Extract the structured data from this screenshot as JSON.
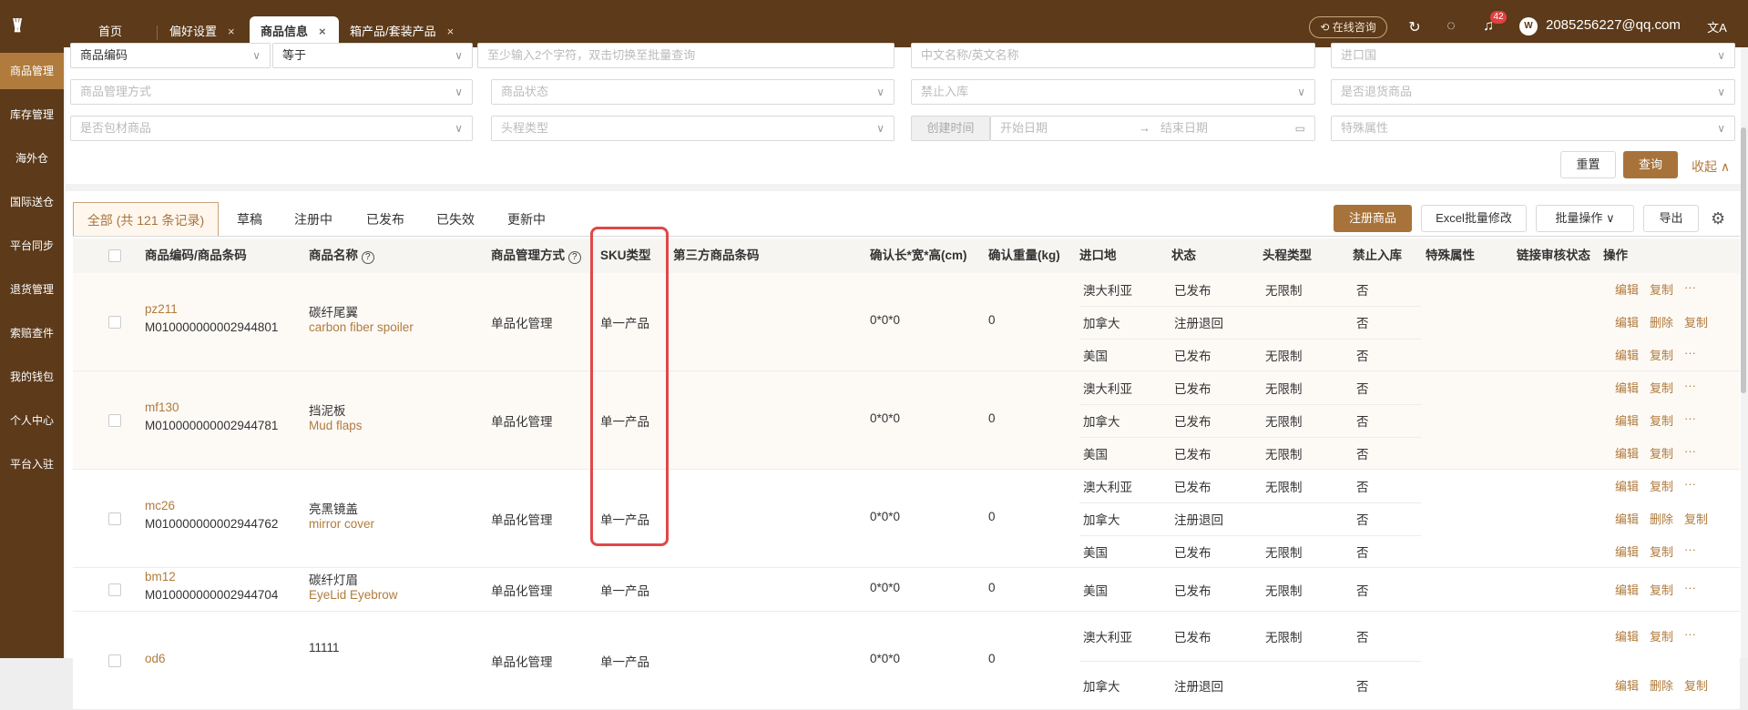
{
  "header": {
    "tabs": [
      {
        "label": "首页",
        "closable": false
      },
      {
        "label": "偏好设置",
        "closable": true
      },
      {
        "label": "商品信息",
        "closable": true,
        "active": true
      },
      {
        "label": "箱产品/套装产品",
        "closable": true
      }
    ],
    "close_glyph": "×",
    "consult_label": "在线咨询",
    "notification_count": "42",
    "avatar_text": "W",
    "email": "2085256227@qq.com",
    "lang_glyph": "文A"
  },
  "sidebar": {
    "items": [
      {
        "label": "商品管理",
        "active": true
      },
      {
        "label": "库存管理"
      },
      {
        "label": "海外仓"
      },
      {
        "label": "国际送仓"
      },
      {
        "label": "平台同步"
      },
      {
        "label": "退货管理"
      },
      {
        "label": "索赔查件"
      },
      {
        "label": "我的钱包"
      },
      {
        "label": "个人中心"
      },
      {
        "label": "平台入驻"
      }
    ]
  },
  "filters": {
    "code_select": "商品编码",
    "operator": "等于",
    "code_placeholder": "至少输入2个字符，双击切换至批量查询",
    "name_placeholder": "中文名称/英文名称",
    "import_country": "进口国",
    "manage_mode": "商品管理方式",
    "status": "商品状态",
    "forbid_inbound": "禁止入库",
    "is_return": "是否退货商品",
    "is_packaging": "是否包材商品",
    "first_leg": "头程类型",
    "created_label": "创建时间",
    "start_date": "开始日期",
    "arrow": "→",
    "end_date": "结束日期",
    "special_attr": "特殊属性",
    "reset": "重置",
    "query": "查询",
    "collapse": "收起 ∧"
  },
  "status_tabs": [
    "全部 (共 121 条记录)",
    "草稿",
    "注册中",
    "已发布",
    "已失效",
    "更新中"
  ],
  "actions": {
    "register": "注册商品",
    "excel": "Excel批量修改",
    "batch": "批量操作",
    "export": "导出"
  },
  "table": {
    "headers": [
      "商品编码/商品条码",
      "商品名称",
      "商品管理方式",
      "SKU类型",
      "第三方商品条码",
      "确认长*宽*高(cm)",
      "确认重量(kg)",
      "进口地",
      "状态",
      "头程类型",
      "禁止入库",
      "特殊属性",
      "链接审核状态",
      "操作"
    ],
    "rows": [
      {
        "code": "pz211",
        "barcode": "M010000000002944801",
        "cn": "碳纤尾翼",
        "en": "carbon fiber spoiler",
        "mode": "单品化管理",
        "sku": "单一产品",
        "dims": "0*0*0",
        "weight": "0",
        "subs": [
          {
            "country": "澳大利亚",
            "status": "已发布",
            "leg": "无限制",
            "forbid": "否",
            "ops": [
              "编辑",
              "复制",
              "···"
            ]
          },
          {
            "country": "加拿大",
            "status": "注册退回",
            "leg": "",
            "forbid": "否",
            "ops": [
              "编辑",
              "删除",
              "复制"
            ]
          },
          {
            "country": "美国",
            "status": "已发布",
            "leg": "无限制",
            "forbid": "否",
            "ops": [
              "编辑",
              "复制",
              "···"
            ]
          }
        ]
      },
      {
        "code": "mf130",
        "barcode": "M010000000002944781",
        "cn": "挡泥板",
        "en": "Mud flaps",
        "mode": "单品化管理",
        "sku": "单一产品",
        "dims": "0*0*0",
        "weight": "0",
        "subs": [
          {
            "country": "澳大利亚",
            "status": "已发布",
            "leg": "无限制",
            "forbid": "否",
            "ops": [
              "编辑",
              "复制",
              "···"
            ]
          },
          {
            "country": "加拿大",
            "status": "已发布",
            "leg": "无限制",
            "forbid": "否",
            "ops": [
              "编辑",
              "复制",
              "···"
            ]
          },
          {
            "country": "美国",
            "status": "已发布",
            "leg": "无限制",
            "forbid": "否",
            "ops": [
              "编辑",
              "复制",
              "···"
            ]
          }
        ]
      },
      {
        "code": "mc26",
        "barcode": "M010000000002944762",
        "cn": "亮黑镜盖",
        "en": "mirror cover",
        "mode": "单品化管理",
        "sku": "单一产品",
        "dims": "0*0*0",
        "weight": "0",
        "subs": [
          {
            "country": "澳大利亚",
            "status": "已发布",
            "leg": "无限制",
            "forbid": "否",
            "ops": [
              "编辑",
              "复制",
              "···"
            ]
          },
          {
            "country": "加拿大",
            "status": "注册退回",
            "leg": "",
            "forbid": "否",
            "ops": [
              "编辑",
              "删除",
              "复制"
            ]
          },
          {
            "country": "美国",
            "status": "已发布",
            "leg": "无限制",
            "forbid": "否",
            "ops": [
              "编辑",
              "复制",
              "···"
            ]
          }
        ]
      },
      {
        "code": "bm12",
        "barcode": "M010000000002944704",
        "cn": "碳纤灯眉",
        "en": "EyeLid Eyebrow",
        "mode": "单品化管理",
        "sku": "单一产品",
        "dims": "0*0*0",
        "weight": "0",
        "subs": [
          {
            "country": "美国",
            "status": "已发布",
            "leg": "无限制",
            "forbid": "否",
            "ops": [
              "编辑",
              "复制",
              "···"
            ]
          }
        ]
      },
      {
        "code": "od6",
        "barcode": "",
        "cn": "11111",
        "en": "",
        "mode": "单品化管理",
        "sku": "单一产品",
        "dims": "0*0*0",
        "weight": "0",
        "subs": [
          {
            "country": "澳大利亚",
            "status": "已发布",
            "leg": "无限制",
            "forbid": "否",
            "ops": [
              "编辑",
              "复制",
              "···"
            ]
          },
          {
            "country": "加拿大",
            "status": "注册退回",
            "leg": "",
            "forbid": "否",
            "ops": [
              "编辑",
              "删除",
              "复制"
            ]
          }
        ]
      }
    ]
  }
}
